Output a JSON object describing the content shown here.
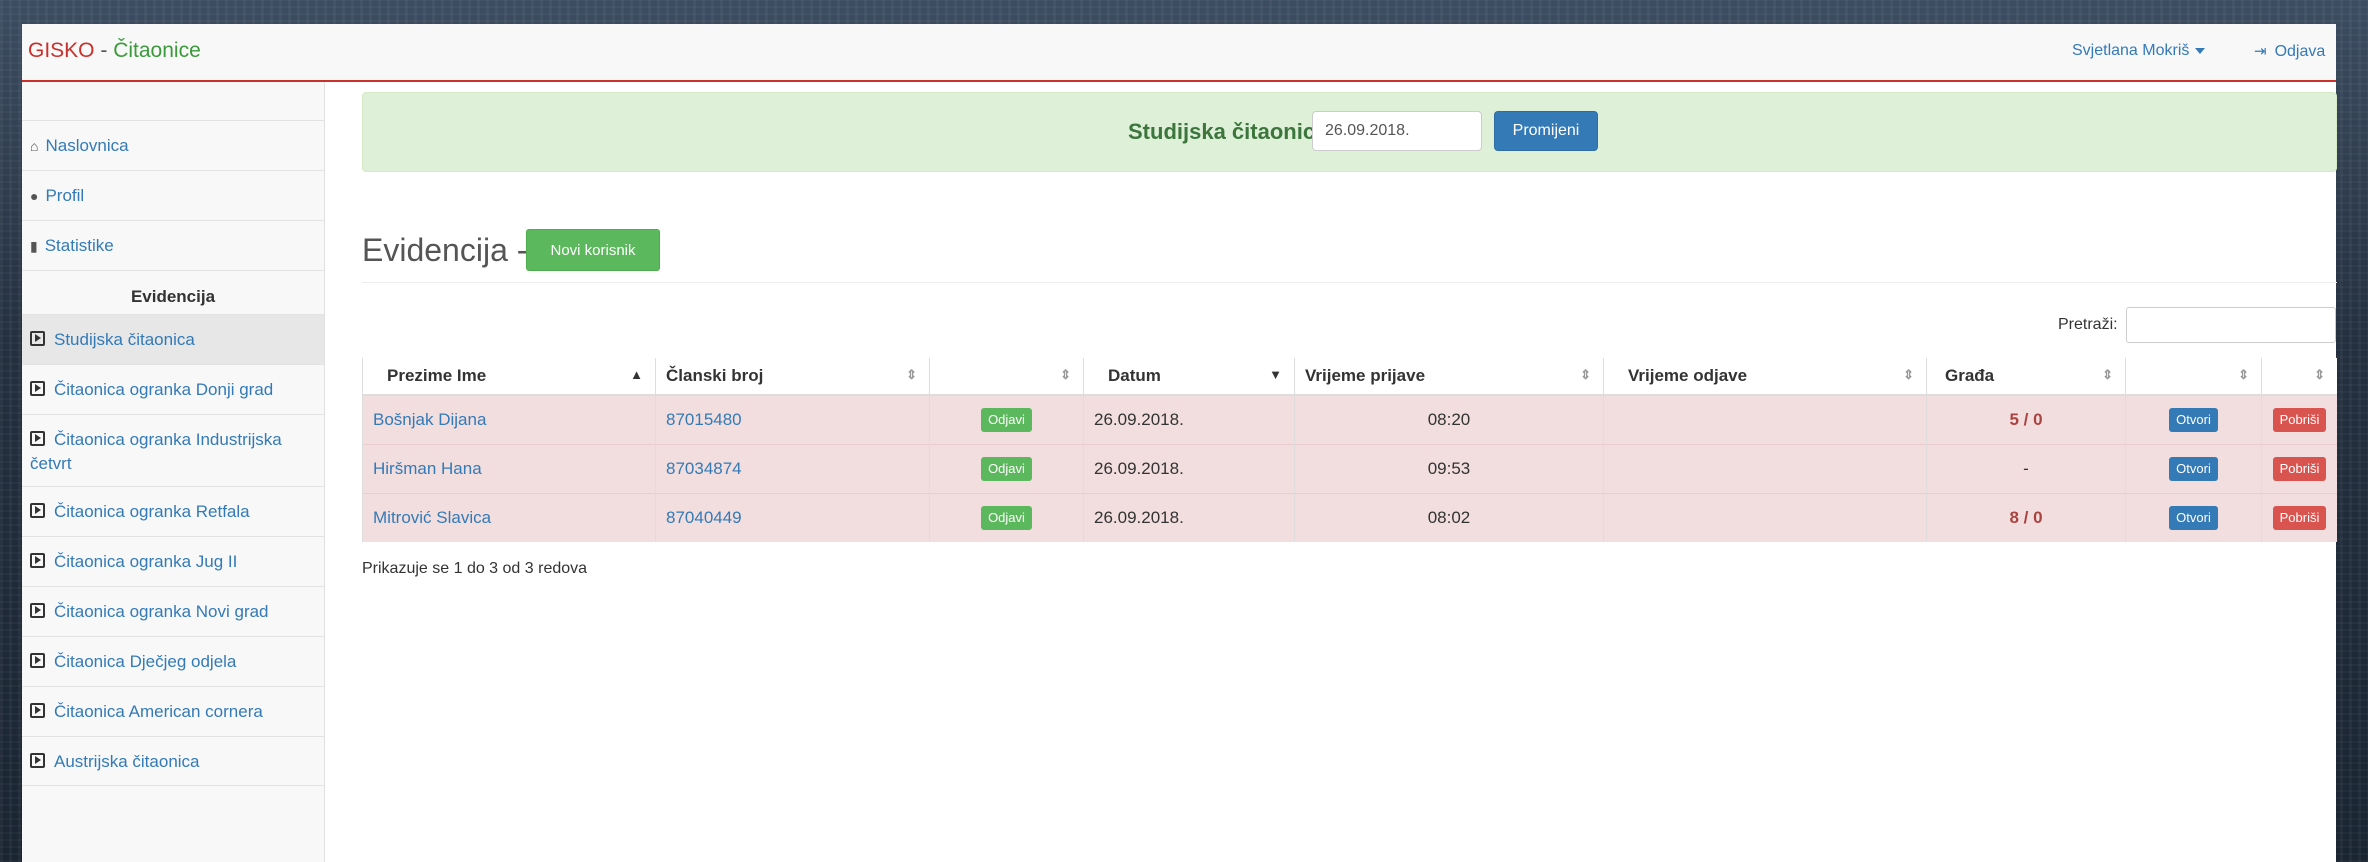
{
  "navbar": {
    "brand_part1": "GISKO",
    "brand_sep": " - ",
    "brand_part2": "Čitaonice",
    "user_name": "Svjetlana Mokriš",
    "logout_label": "Odjava"
  },
  "sidebar": {
    "top_items": [
      {
        "label": "Naslovnica",
        "icon": "home-icon"
      },
      {
        "label": "Profil",
        "icon": "user-icon"
      },
      {
        "label": "Statistike",
        "icon": "bar-chart-icon"
      }
    ],
    "section_title": "Evidencija",
    "reading_rooms": [
      "Studijska čitaonica",
      "Čitaonica ogranka Donji grad",
      "Čitaonica ogranka Industrijska četvrt",
      "Čitaonica ogranka Retfala",
      "Čitaonica ogranka Jug II",
      "Čitaonica ogranka Novi grad",
      "Čitaonica Dječjeg odjela",
      "Čitaonica American cornera",
      "Austrijska čitaonica"
    ]
  },
  "banner": {
    "label": "Studijska čitaonica",
    "date_value": "26.09.2018.",
    "change_button": "Promijeni"
  },
  "page": {
    "title": "Evidencija -",
    "new_user_button": "Novi korisnik",
    "search_label": "Pretraži:",
    "footer_info": "Prikazuje se 1 do 3 od 3 redova"
  },
  "table": {
    "headers": [
      "Prezime Ime",
      "Članski broj",
      "",
      "Datum",
      "Vrijeme prijave",
      "Vrijeme odjave",
      "Građa",
      "",
      ""
    ],
    "rows": [
      {
        "name": "Bošnjak Dijana",
        "member_no": "87015480",
        "checkout": "Odjavi",
        "date": "26.09.2018.",
        "time_in": "08:20",
        "time_out": "",
        "items": "5 / 0",
        "open": "Otvori",
        "delete": "Pobriši"
      },
      {
        "name": "Hiršman Hana",
        "member_no": "87034874",
        "checkout": "Odjavi",
        "date": "26.09.2018.",
        "time_in": "09:53",
        "time_out": "",
        "items": "-",
        "open": "Otvori",
        "delete": "Pobriši"
      },
      {
        "name": "Mitrović Slavica",
        "member_no": "87040449",
        "checkout": "Odjavi",
        "date": "26.09.2018.",
        "time_in": "08:02",
        "time_out": "",
        "items": "8 / 0",
        "open": "Otvori",
        "delete": "Pobriši"
      }
    ]
  }
}
